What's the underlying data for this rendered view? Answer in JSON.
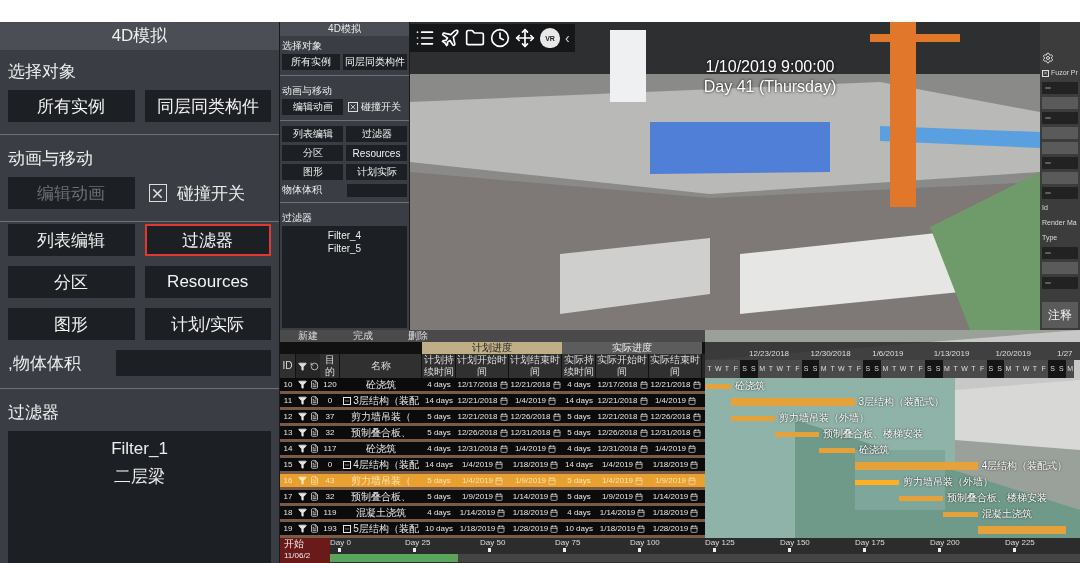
{
  "main_panel": {
    "title": "4D模拟",
    "select_label": "选择对象",
    "select_buttons": [
      "所有实例",
      "同层同类构件"
    ],
    "anim_label": "动画与移动",
    "edit_button": {
      "label": "编辑动画",
      "disabled": true
    },
    "collision": {
      "label": "碰撞开关",
      "checked": true
    },
    "tool_buttons": [
      {
        "label": "列表编辑",
        "highlighted": false
      },
      {
        "label": "过滤器",
        "highlighted": true
      },
      {
        "label": "分区",
        "highlighted": false
      },
      {
        "label": "Resources",
        "highlighted": false
      },
      {
        "label": "图形",
        "highlighted": false
      },
      {
        "label": "计划/实际",
        "highlighted": false
      }
    ],
    "volume_label": ",物体体积",
    "filter_label": "过滤器",
    "filters": [
      "Filter_1",
      "二层梁"
    ]
  },
  "mini_panel": {
    "title": "4D模拟",
    "select_label": "选择对象",
    "select_buttons": [
      "所有实例",
      "同层同类构件"
    ],
    "anim_label": "动画与移动",
    "edit_button": {
      "label": "编辑动画",
      "disabled": false
    },
    "collision": {
      "label": "碰撞开关",
      "checked": true
    },
    "tool_buttons": [
      {
        "label": "列表编辑",
        "highlighted": false
      },
      {
        "label": "过滤器",
        "highlighted": false
      },
      {
        "label": "分区",
        "highlighted": false
      },
      {
        "label": "Resources",
        "highlighted": false
      },
      {
        "label": "图形",
        "highlighted": false
      },
      {
        "label": "计划实际",
        "highlighted": false
      }
    ],
    "volume_label": "物体体积",
    "filter_label": "过滤器",
    "filters": [
      "Filter_4",
      "Filter_5"
    ]
  },
  "viewport": {
    "toolbar": {
      "vr_badge": "VR",
      "collapse": "‹"
    },
    "time": "1/10/2019 9:00:00",
    "day": "Day 41 (Thursday)"
  },
  "properties": [
    {
      "kind": "checkbox",
      "label": "Fuzor Pr",
      "checked": true
    },
    {
      "kind": "group"
    },
    {
      "kind": "field"
    },
    {
      "kind": "group"
    },
    {
      "kind": "field"
    },
    {
      "kind": "field"
    },
    {
      "kind": "group"
    },
    {
      "kind": "field"
    },
    {
      "kind": "group"
    },
    {
      "kind": "text",
      "label": "Id"
    },
    {
      "kind": "text",
      "label": "Render Ma"
    },
    {
      "kind": "text",
      "label": "Type"
    },
    {
      "kind": "group"
    },
    {
      "kind": "field"
    },
    {
      "kind": "group"
    },
    {
      "kind": "button",
      "label": "注释"
    }
  ],
  "schedule": {
    "tabs": [
      "新建",
      "完成",
      "删除"
    ],
    "groups": [
      "计划进度",
      "实际进度"
    ],
    "columns": [
      "ID",
      "目的",
      "名称",
      "计划持续时间",
      "计划开始时间",
      "计划结束时间",
      "实际持续时间",
      "实际开始时间",
      "实际结束时间"
    ],
    "rows": [
      {
        "id": "10",
        "target": "120",
        "name": "砼浇筑",
        "group": false,
        "selected": false,
        "plan_duration": "4 days",
        "plan_start": "12/17/2018",
        "plan_end": "12/21/2018",
        "actual_duration": "4 days",
        "actual_start": "12/17/2018",
        "actual_end": "12/21/2018"
      },
      {
        "id": "11",
        "target": "0",
        "name": "3层结构（装配",
        "group": true,
        "selected": false,
        "plan_duration": "14 days",
        "plan_start": "12/21/2018",
        "plan_end": "1/4/2019",
        "actual_duration": "14 days",
        "actual_start": "12/21/2018",
        "actual_end": "1/4/2019"
      },
      {
        "id": "12",
        "target": "37",
        "name": "剪力墙吊装（",
        "group": false,
        "selected": false,
        "plan_duration": "5 days",
        "plan_start": "12/21/2018",
        "plan_end": "12/26/2018",
        "actual_duration": "5 days",
        "actual_start": "12/21/2018",
        "actual_end": "12/26/2018"
      },
      {
        "id": "13",
        "target": "32",
        "name": "预制叠合板、",
        "group": false,
        "selected": false,
        "plan_duration": "5 days",
        "plan_start": "12/26/2018",
        "plan_end": "12/31/2018",
        "actual_duration": "5 days",
        "actual_start": "12/26/2018",
        "actual_end": "12/31/2018"
      },
      {
        "id": "14",
        "target": "117",
        "name": "砼浇筑",
        "group": false,
        "selected": false,
        "plan_duration": "4 days",
        "plan_start": "12/31/2018",
        "plan_end": "1/4/2019",
        "actual_duration": "4 days",
        "actual_start": "12/31/2018",
        "actual_end": "1/4/2019"
      },
      {
        "id": "15",
        "target": "0",
        "name": "4层结构（装配",
        "group": true,
        "selected": false,
        "plan_duration": "14 days",
        "plan_start": "1/4/2019",
        "plan_end": "1/18/2019",
        "actual_duration": "14 days",
        "actual_start": "1/4/2019",
        "actual_end": "1/18/2019"
      },
      {
        "id": "16",
        "target": "43",
        "name": "剪力墙吊装（",
        "group": false,
        "selected": true,
        "plan_duration": "5 days",
        "plan_start": "1/4/2019",
        "plan_end": "1/9/2019",
        "actual_duration": "5 days",
        "actual_start": "1/4/2019",
        "actual_end": "1/9/2019"
      },
      {
        "id": "17",
        "target": "32",
        "name": "预制叠合板、",
        "group": false,
        "selected": false,
        "plan_duration": "5 days",
        "plan_start": "1/9/2019",
        "plan_end": "1/14/2019",
        "actual_duration": "5 days",
        "actual_start": "1/9/2019",
        "actual_end": "1/14/2019"
      },
      {
        "id": "18",
        "target": "119",
        "name": "混凝土浇筑",
        "group": false,
        "selected": false,
        "plan_duration": "4 days",
        "plan_start": "1/14/2019",
        "plan_end": "1/18/2019",
        "actual_duration": "4 days",
        "actual_start": "1/14/2019",
        "actual_end": "1/18/2019"
      },
      {
        "id": "19",
        "target": "193",
        "name": "5层结构（装配",
        "group": true,
        "selected": false,
        "plan_duration": "10 days",
        "plan_start": "1/18/2019",
        "plan_end": "1/28/2019",
        "actual_duration": "10 days",
        "actual_start": "1/18/2019",
        "actual_end": "1/28/2019"
      }
    ]
  },
  "gantt": {
    "dates": [
      "12/23/2018",
      "12/30/2018",
      "1/6/2019",
      "1/13/2019",
      "1/20/2019",
      "1/27"
    ],
    "day_letters": [
      "T",
      "W",
      "T",
      "F",
      "S",
      "S",
      "M",
      "T",
      "W",
      "T",
      "F",
      "S",
      "S",
      "M",
      "T",
      "W",
      "T",
      "F",
      "S",
      "S",
      "M",
      "T",
      "W",
      "T",
      "F",
      "S",
      "S",
      "M",
      "T",
      "W",
      "T",
      "F",
      "S",
      "S",
      "M",
      "T",
      "W",
      "T",
      "F",
      "S",
      "S",
      "M"
    ],
    "bars": [
      {
        "label": "砼浇筑"
      },
      {
        "label": "3层结构（装配式）"
      },
      {
        "label": "剪力墙吊装（外墙）"
      },
      {
        "label": "预制叠合板、楼梯安装"
      },
      {
        "label": "砼浇筑"
      },
      {
        "label": "4层结构（装配式）"
      },
      {
        "label": "剪力墙吊装（外墙）"
      },
      {
        "label": "预制叠合板、楼梯安装"
      },
      {
        "label": "混凝土浇筑"
      }
    ]
  },
  "timeline": {
    "start_label": "开始",
    "date": "11/06/2",
    "ticks": [
      "Day 0",
      "Day 25",
      "Day 50",
      "Day 75",
      "Day 100",
      "Day 125",
      "Day 150",
      "Day 175",
      "Day 200",
      "Day 225"
    ],
    "level": 0.17
  }
}
